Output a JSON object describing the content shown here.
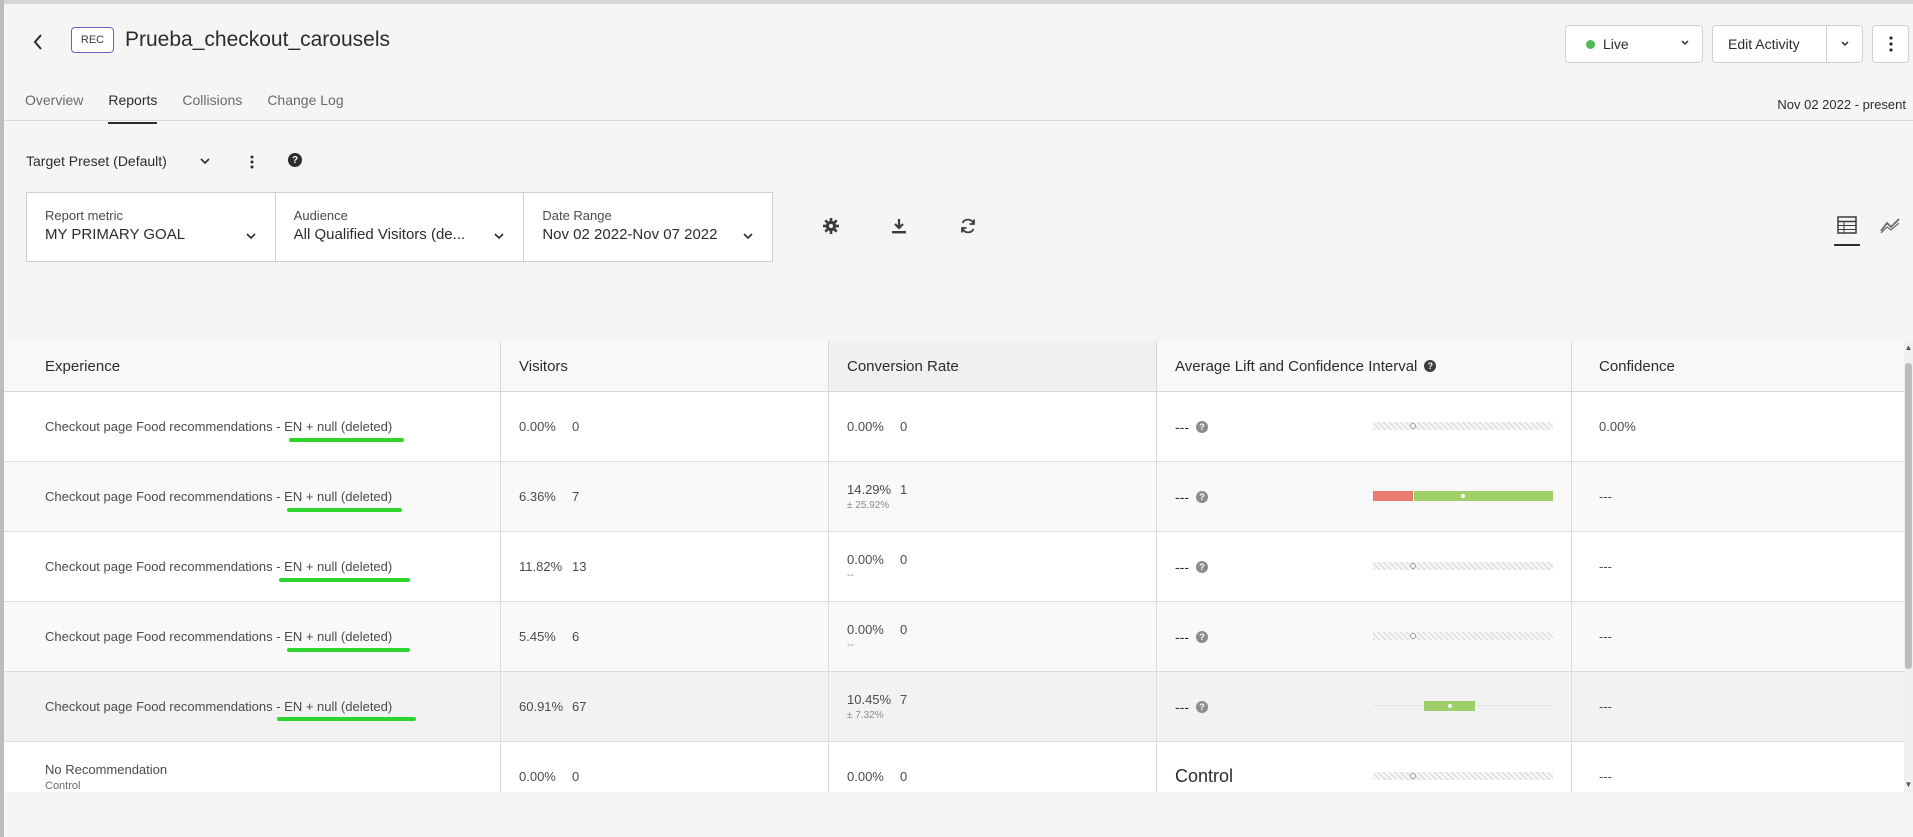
{
  "activity": {
    "badge": "REC",
    "title": "Prueba_checkout_carousels",
    "status": "Live",
    "status_color": "#4fbb53",
    "edit_label": "Edit Activity"
  },
  "tabs": [
    {
      "label": "Overview",
      "active": false
    },
    {
      "label": "Reports",
      "active": true
    },
    {
      "label": "Collisions",
      "active": false
    },
    {
      "label": "Change Log",
      "active": false
    }
  ],
  "date_range_label": "Nov 02 2022 - present",
  "preset": {
    "label": "Target Preset (Default)",
    "help": "?"
  },
  "filters": {
    "metric": {
      "label": "Report metric",
      "value": "MY PRIMARY GOAL"
    },
    "audience": {
      "label": "Audience",
      "value": "All Qualified Visitors (de..."
    },
    "date": {
      "label": "Date Range",
      "value": "Nov 02 2022-Nov 07 2022"
    }
  },
  "toolbar_icons": [
    "gear-icon",
    "download-icon",
    "refresh-icon",
    "table-view-icon",
    "line-chart-icon"
  ],
  "table": {
    "headers": {
      "experience": "Experience",
      "visitors": "Visitors",
      "conversion": "Conversion Rate",
      "lift": "Average Lift and Confidence Interval",
      "confidence": "Confidence"
    },
    "rows": [
      {
        "name": "Checkout page Food recommendations - EN + null (deleted)",
        "sub": "",
        "visitors_pct": "0.00%",
        "visitors": "0",
        "conv_pct": "0.00%",
        "conv": "0",
        "conv_ci": "",
        "lift": "---",
        "confidence": "0.00%"
      },
      {
        "name": "Checkout page Food recommendations - EN + null (deleted)",
        "sub": "",
        "visitors_pct": "6.36%",
        "visitors": "7",
        "conv_pct": "14.29%",
        "conv": "1",
        "conv_ci": "± 25.92%",
        "lift": "---",
        "confidence": "---"
      },
      {
        "name": "Checkout page Food recommendations - EN + null (deleted)",
        "sub": "",
        "visitors_pct": "11.82%",
        "visitors": "13",
        "conv_pct": "0.00%",
        "conv": "0",
        "conv_ci": "--",
        "lift": "---",
        "confidence": "---"
      },
      {
        "name": "Checkout page Food recommendations - EN + null (deleted)",
        "sub": "",
        "visitors_pct": "5.45%",
        "visitors": "6",
        "conv_pct": "0.00%",
        "conv": "0",
        "conv_ci": "--",
        "lift": "---",
        "confidence": "---"
      },
      {
        "name": "Checkout page Food recommendations - EN + null (deleted)",
        "sub": "",
        "visitors_pct": "60.91%",
        "visitors": "67",
        "conv_pct": "10.45%",
        "conv": "7",
        "conv_ci": "± 7.32%",
        "lift": "---",
        "confidence": "---"
      },
      {
        "name": "No Recommendation",
        "sub": "Control",
        "visitors_pct": "0.00%",
        "visitors": "0",
        "conv_pct": "0.00%",
        "conv": "0",
        "conv_ci": "",
        "lift": "Control",
        "confidence": "---"
      }
    ]
  },
  "colors": {
    "underline_annotation": "#2ed52e",
    "ci_negative": "#ec7a72",
    "ci_positive": "#9fcf6a"
  }
}
